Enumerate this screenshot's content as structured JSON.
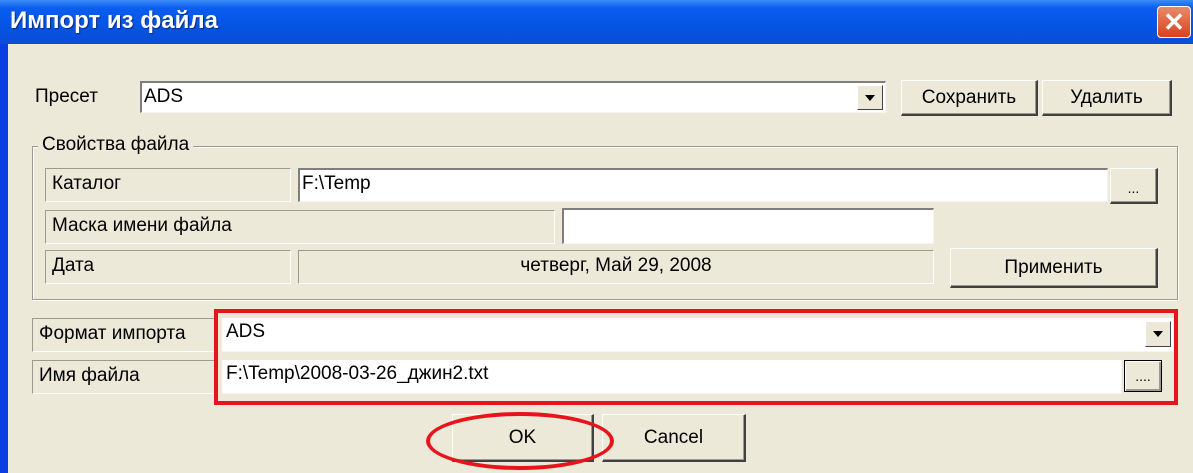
{
  "window": {
    "title": "Импорт из файла",
    "close_symbol": "✕",
    "colors": {
      "titlebar": "#0554e3",
      "face": "#ece9d8",
      "highlight": "#e8141c"
    }
  },
  "preset": {
    "label": "Пресет",
    "value": "ADS",
    "save_label": "Сохранить",
    "delete_label": "Удалить"
  },
  "file_properties": {
    "group_title": "Свойства файла",
    "catalog_label": "Каталог",
    "catalog_value": "F:\\Temp",
    "browse_label": "...",
    "mask_label": "Маска имени файла",
    "mask_value": "",
    "date_label": "Дата",
    "date_value": "четверг, Май 29, 2008",
    "apply_label": "Применить"
  },
  "import": {
    "format_label": "Формат импорта",
    "format_value": "ADS",
    "filename_label": "Имя файла",
    "filename_value": "F:\\Temp\\2008-03-26_джин2.txt",
    "browse_label": "...."
  },
  "footer": {
    "ok_label": "OK",
    "cancel_label": "Cancel"
  }
}
